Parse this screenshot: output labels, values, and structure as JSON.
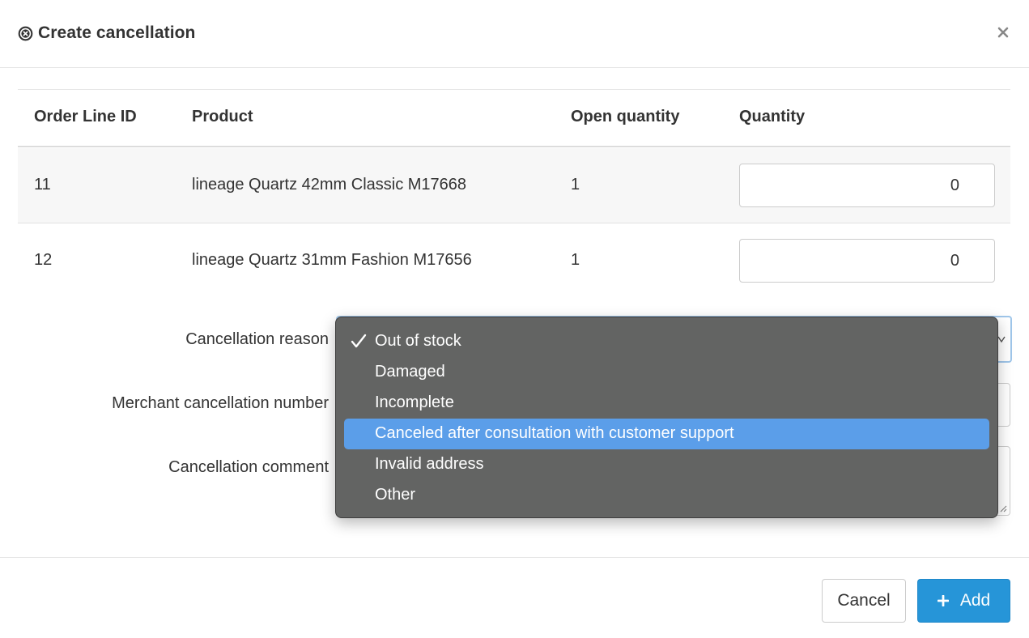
{
  "header": {
    "icon": "circle-x-icon",
    "title": "Create cancellation",
    "close_icon": "close-icon"
  },
  "table": {
    "columns": [
      "Order Line ID",
      "Product",
      "Open quantity",
      "Quantity"
    ],
    "rows": [
      {
        "order_line_id": "11",
        "product": "lineage Quartz 42mm Classic M17668",
        "open_quantity": "1",
        "quantity": "0"
      },
      {
        "order_line_id": "12",
        "product": "lineage Quartz 31mm Fashion M17656",
        "open_quantity": "1",
        "quantity": "0"
      }
    ]
  },
  "form": {
    "cancellation_reason_label": "Cancellation reason",
    "merchant_number_label": "Merchant cancellation number",
    "comment_label": "Cancellation comment"
  },
  "dropdown": {
    "selected": "Out of stock",
    "highlighted": "Canceled after consultation with customer support",
    "options": [
      "Out of stock",
      "Damaged",
      "Incomplete",
      "Canceled after consultation with customer support",
      "Invalid address",
      "Other"
    ]
  },
  "footer": {
    "cancel_label": "Cancel",
    "add_label": "Add",
    "add_icon": "plus-icon"
  },
  "colors": {
    "primary": "#2695d8",
    "dropdown_bg": "#636463",
    "dropdown_highlight": "#5b9ee9"
  }
}
